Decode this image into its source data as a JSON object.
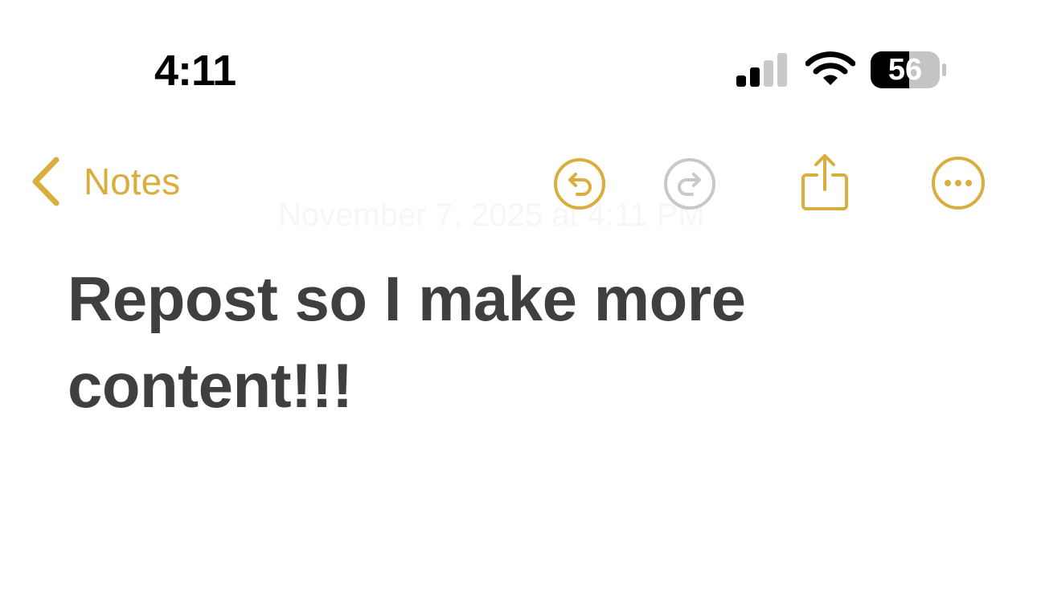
{
  "status_bar": {
    "time": "4:11",
    "battery_percent": "56",
    "signal_bars_active": 2,
    "signal_bars_total": 4,
    "icons": [
      "cellular-signal-icon",
      "wifi-icon",
      "battery-icon"
    ]
  },
  "nav": {
    "back_label": "Notes",
    "icons": [
      "chevron-left-icon",
      "undo-icon",
      "redo-icon",
      "share-icon",
      "more-icon"
    ],
    "redo_enabled": false
  },
  "note": {
    "date": "November 7, 2025 at 4:11 PM",
    "body": "Repost so I make more content!!!"
  },
  "colors": {
    "accent": "#d9ae3e",
    "disabled": "#c8c8c8",
    "text": "#3f3f3f",
    "background": "#ffffff"
  }
}
